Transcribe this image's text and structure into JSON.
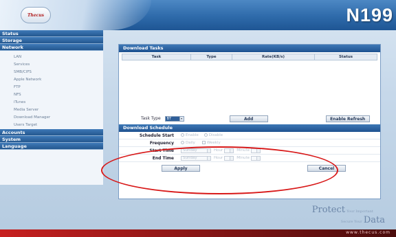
{
  "header": {
    "logo_text": "Thecus",
    "model": "N199"
  },
  "sidebar": {
    "groups": [
      {
        "label": "Status"
      },
      {
        "label": "Storage"
      },
      {
        "label": "Network",
        "items": [
          "LAN",
          "Services",
          "SMB/CIFS",
          "Apple Network",
          "FTP",
          "NFS",
          "iTunes",
          "Media Server",
          "Download Manager",
          "Users Target"
        ]
      },
      {
        "label": "Accounts"
      },
      {
        "label": "System"
      },
      {
        "label": "Language"
      }
    ]
  },
  "download_tasks": {
    "title": "Download Tasks",
    "columns": [
      "Task",
      "Type",
      "Rate(KB/s)",
      "Status"
    ],
    "task_type_label": "Task Type",
    "task_type_value": "BT",
    "add_label": "Add",
    "refresh_label": "Enable Refresh"
  },
  "download_schedule": {
    "title": "Download Schedule",
    "schedule_start_label": "Schedule Start",
    "schedule_options": [
      "Enable",
      "Disable"
    ],
    "frequency_label": "Frequency",
    "frequency_options": [
      "Daily",
      "Weekly"
    ],
    "start_time_label": "Start Time",
    "end_time_label": "End Time",
    "day_value": "Sunday",
    "hour_label": "Hour",
    "minute_label": "Minute",
    "apply_label": "Apply",
    "cancel_label": "Cancel"
  },
  "footer": {
    "tagline_big": "Protect",
    "tagline_small_1": "Your Important",
    "tagline_small_2": "Secure Your",
    "tagline_big_2": "Data",
    "url": "www.thecus.com"
  },
  "colors": {
    "header": "#2e6aaa",
    "accent": "#1f5290",
    "annotation": "#d81818",
    "footer": "#c72020"
  }
}
